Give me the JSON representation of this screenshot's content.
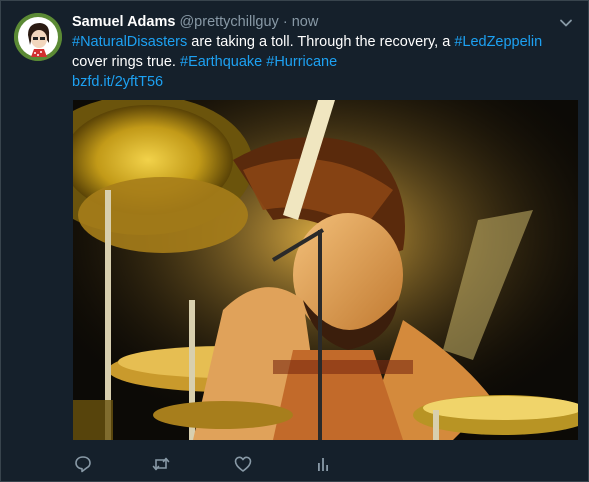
{
  "tweet": {
    "display_name": "Samuel Adams",
    "handle": "@prettychillguy",
    "separator": "·",
    "timestamp": "now",
    "text": {
      "part1_link": "#NaturalDisasters",
      "part2": " are taking a toll. Through the recovery, a ",
      "part3_link": "#LedZeppelin",
      "part4": " cover rings true. ",
      "part5_link": "#Earthquake",
      "part6": " ",
      "part7_link": "#Hurricane",
      "url": "bzfd.it/2yftT56"
    }
  },
  "colors": {
    "background": "#15202b",
    "text": "#ffffff",
    "muted": "#8899a6",
    "link": "#1da1f2",
    "border": "#38444d"
  },
  "icons": {
    "caret": "chevron-down-icon",
    "reply": "reply-icon",
    "retweet": "retweet-icon",
    "like": "heart-icon",
    "analytics": "analytics-icon"
  }
}
